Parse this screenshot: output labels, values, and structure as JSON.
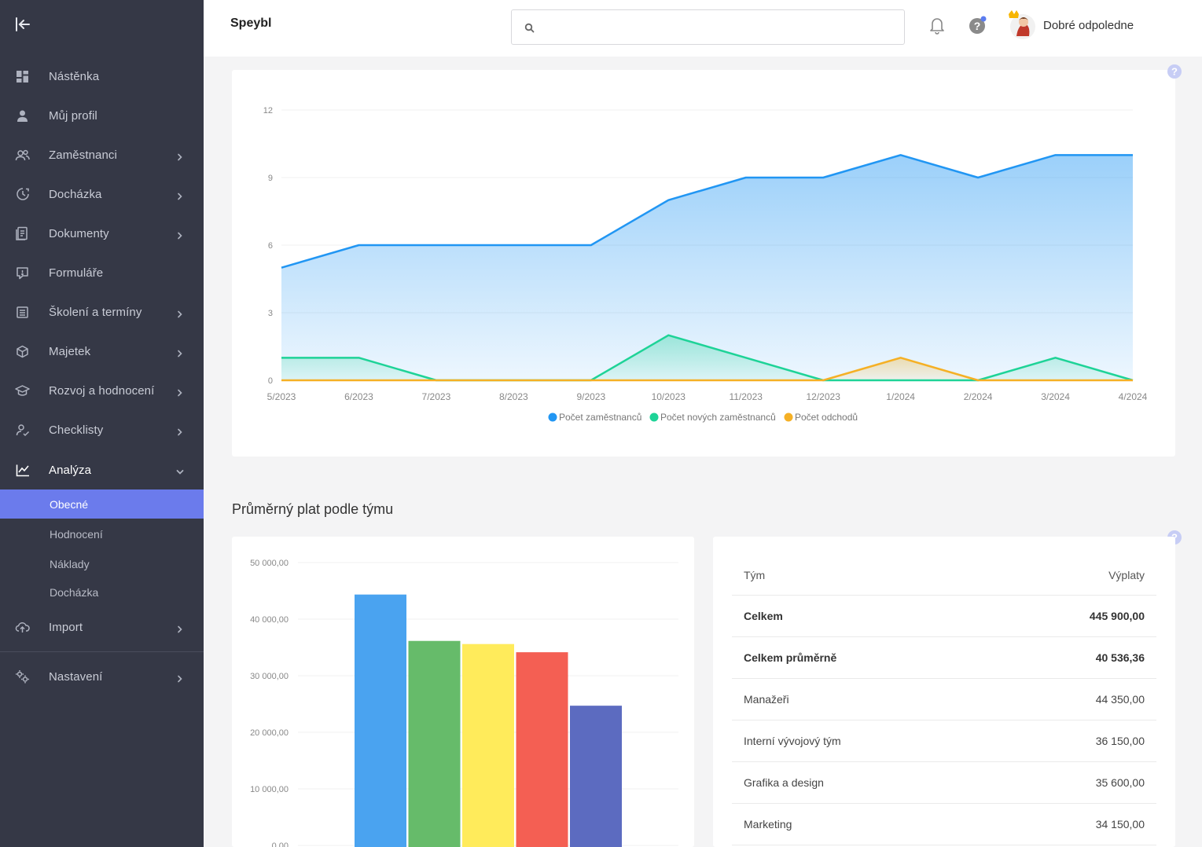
{
  "app": {
    "brand": "Speybl",
    "greeting": "Dobré odpoledne"
  },
  "search": {
    "placeholder": "",
    "value": ""
  },
  "sidebar": {
    "items": [
      {
        "label": "Nástěnka",
        "icon": "dashboard-icon",
        "has_children": false
      },
      {
        "label": "Můj profil",
        "icon": "user-icon",
        "has_children": false
      },
      {
        "label": "Zaměstnanci",
        "icon": "users-icon",
        "has_children": true
      },
      {
        "label": "Docházka",
        "icon": "clock-icon",
        "has_children": true
      },
      {
        "label": "Dokumenty",
        "icon": "document-icon",
        "has_children": true
      },
      {
        "label": "Formuláře",
        "icon": "form-icon",
        "has_children": false
      },
      {
        "label": "Školení a termíny",
        "icon": "calendar-icon",
        "has_children": true
      },
      {
        "label": "Majetek",
        "icon": "box-icon",
        "has_children": true
      },
      {
        "label": "Rozvoj a hodnocení",
        "icon": "graduation-cap-icon",
        "has_children": true
      },
      {
        "label": "Checklisty",
        "icon": "checklist-icon",
        "has_children": true
      },
      {
        "label": "Analýza",
        "icon": "chart-line-icon",
        "has_children": true,
        "expanded": true
      },
      {
        "label": "Import",
        "icon": "cloud-upload-icon",
        "has_children": true
      },
      {
        "label": "Nastavení",
        "icon": "settings-icon",
        "has_children": true
      }
    ],
    "analyza_sub": [
      {
        "label": "Obecné",
        "selected": true
      },
      {
        "label": "Hodnocení",
        "selected": false
      },
      {
        "label": "Náklady",
        "selected": false
      },
      {
        "label": "Docházka",
        "selected": false
      }
    ]
  },
  "section2": {
    "title": "Průměrný plat podle týmu"
  },
  "table": {
    "headers": [
      "Tým",
      "Výplaty"
    ],
    "rows": [
      {
        "team": "Celkem",
        "value": "445 900,00",
        "bold": true
      },
      {
        "team": "Celkem průměrně",
        "value": "40 536,36",
        "bold": true
      },
      {
        "team": "Manažeři",
        "value": "44 350,00",
        "bold": false
      },
      {
        "team": "Interní vývojový tým",
        "value": "36 150,00",
        "bold": false
      },
      {
        "team": "Grafika a design",
        "value": "35 600,00",
        "bold": false
      },
      {
        "team": "Marketing",
        "value": "34 150,00",
        "bold": false
      }
    ]
  },
  "chart_data": [
    {
      "type": "area",
      "x": [
        "5/2023",
        "6/2023",
        "7/2023",
        "8/2023",
        "9/2023",
        "10/2023",
        "11/2023",
        "12/2023",
        "1/2024",
        "2/2024",
        "3/2024",
        "4/2024"
      ],
      "yticks": [
        "0",
        "3",
        "6",
        "9",
        "12"
      ],
      "ylim": [
        0,
        12
      ],
      "grid": true,
      "legend_position": "bottom",
      "series": [
        {
          "name": "Počet zaměstnanců",
          "color": "#2196f3",
          "values": [
            5,
            6,
            6,
            6,
            6,
            8,
            9,
            9,
            10,
            9,
            10,
            10
          ]
        },
        {
          "name": "Počet nových zaměstnanců",
          "color": "#1ed397",
          "values": [
            1,
            1,
            0,
            0,
            0,
            2,
            1,
            0,
            0,
            0,
            1,
            0
          ]
        },
        {
          "name": "Počet odchodů",
          "color": "#f5b025",
          "values": [
            0,
            0,
            0,
            0,
            0,
            0,
            0,
            0,
            1,
            0,
            0,
            0
          ]
        }
      ]
    },
    {
      "type": "bar",
      "yticks": [
        "0,00",
        "10 000,00",
        "20 000,00",
        "30 000,00",
        "40 000,00",
        "50 000,00"
      ],
      "ylim": [
        0,
        50000
      ],
      "grid": true,
      "values": [
        44350,
        36150,
        35600,
        34150,
        24700
      ],
      "colors": [
        "#4aa3f0",
        "#66bb6a",
        "#ffeb5b",
        "#f45f53",
        "#5c6bc0"
      ]
    }
  ]
}
